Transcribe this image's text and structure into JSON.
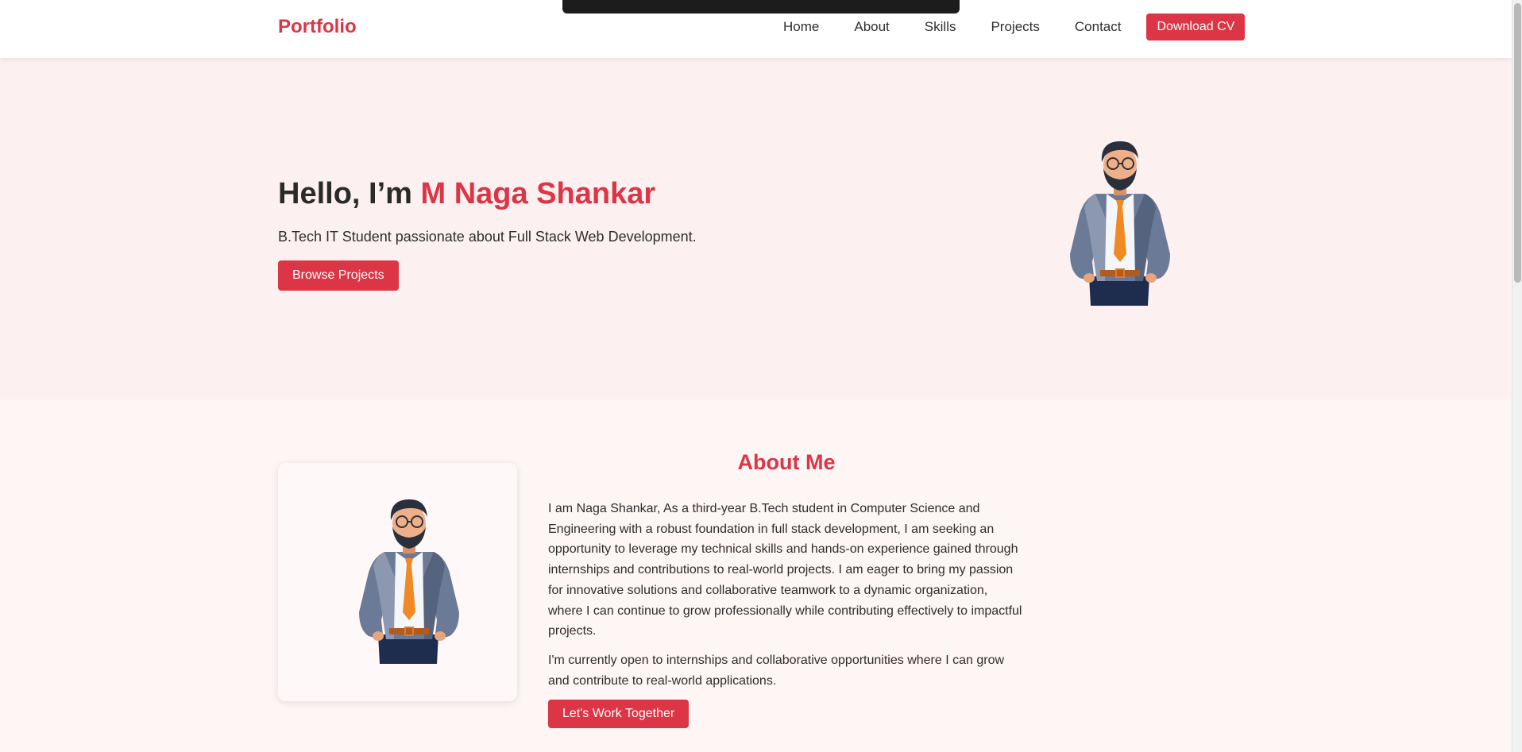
{
  "nav": {
    "brand": "Portfolio",
    "links": [
      "Home",
      "About",
      "Skills",
      "Projects",
      "Contact"
    ],
    "cv_label": "Download CV"
  },
  "hero": {
    "greeting": "Hello, I’m ",
    "name": "M Naga Shankar",
    "subtitle": "B.Tech IT Student passionate about Full Stack Web Development.",
    "button_label": "Browse Projects"
  },
  "about": {
    "title": "About Me",
    "paragraph1": "I am Naga Shankar, As a third-year B.Tech student in Computer Science and Engineering with a robust foundation in full stack development, I am seeking an opportunity to leverage my technical skills and hands-on experience gained through internships and contributions to real-world projects. I am eager to bring my passion for innovative solutions and collaborative teamwork to a dynamic organization, where I can continue to grow professionally while contributing effectively to impactful projects.",
    "paragraph2": "I'm currently open to internships and collaborative opportunities where I can grow and contribute to real-world applications.",
    "button_label": "Let's Work Together"
  },
  "colors": {
    "accent": "#dc3545",
    "hero_bg": "#fdf0f0",
    "about_bg": "#fef5f5"
  }
}
